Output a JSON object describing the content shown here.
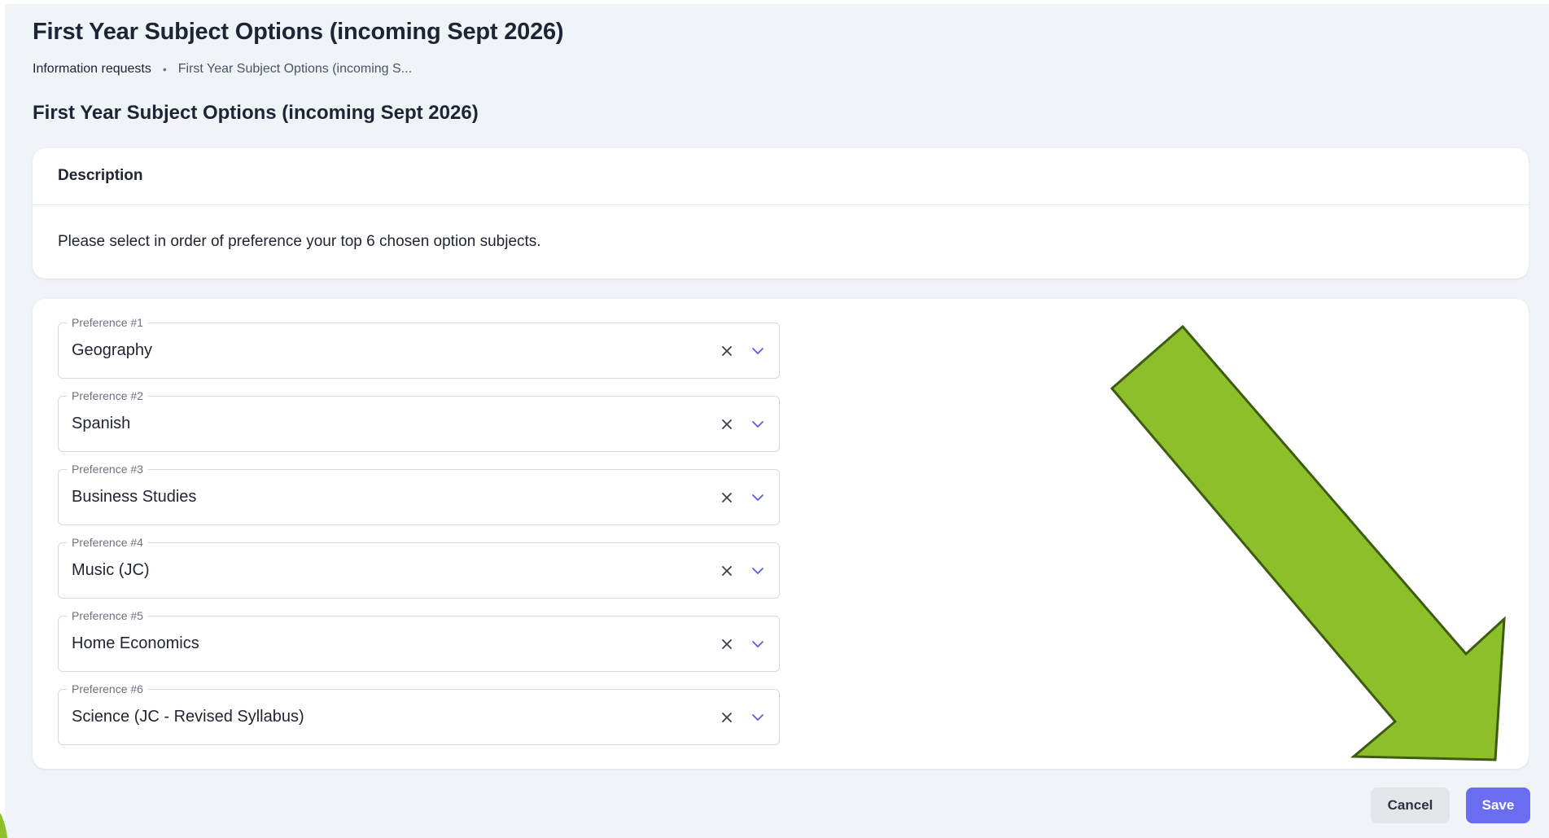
{
  "page": {
    "title": "First Year Subject Options (incoming Sept 2026)",
    "breadcrumb": {
      "parent": "Information requests",
      "separator": "•",
      "current": "First Year Subject Options (incoming S..."
    },
    "form_title": "First Year Subject Options (incoming Sept 2026)"
  },
  "description": {
    "heading": "Description",
    "text": "Please select in order of preference your top 6 chosen option subjects."
  },
  "preferences": [
    {
      "label": "Preference #1",
      "value": "Geography"
    },
    {
      "label": "Preference #2",
      "value": "Spanish"
    },
    {
      "label": "Preference #3",
      "value": "Business Studies"
    },
    {
      "label": "Preference #4",
      "value": "Music (JC)"
    },
    {
      "label": "Preference #5",
      "value": "Home Economics"
    },
    {
      "label": "Preference #6",
      "value": "Science (JC - Revised Syllabus)"
    }
  ],
  "actions": {
    "cancel_label": "Cancel",
    "save_label": "Save"
  },
  "icons": {
    "clear": "close-icon",
    "expand": "chevron-down-icon"
  },
  "colors": {
    "background": "#f0f3f8",
    "card": "#ffffff",
    "accent": "#6a6df0",
    "cancel_bg": "#e3e5e9",
    "annotation_arrow": "#8dbf2a",
    "annotation_outline": "#3d5c10"
  }
}
